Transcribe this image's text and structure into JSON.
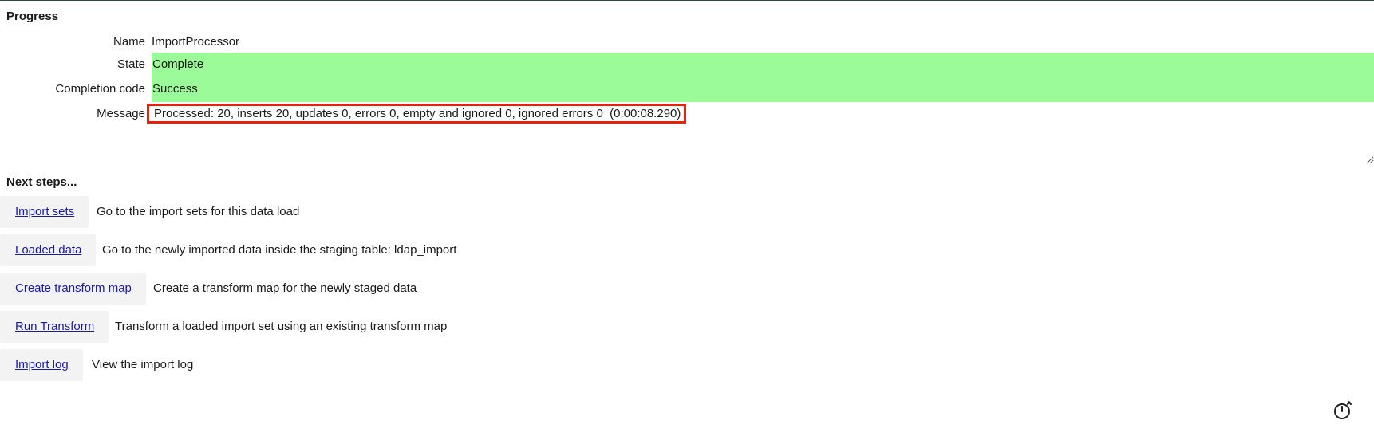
{
  "progress": {
    "title": "Progress",
    "fields": {
      "name": {
        "label": "Name",
        "value": "ImportProcessor"
      },
      "state": {
        "label": "State",
        "value": "Complete"
      },
      "completion_code": {
        "label": "Completion code",
        "value": "Success"
      },
      "message": {
        "label": "Message",
        "value": "Processed: 20, inserts 20, updates 0, errors 0, empty and ignored 0, ignored errors 0  (0:00:08.290)"
      }
    },
    "status_color": "#9bfb98",
    "highlight_color": "#e8210b"
  },
  "next_steps": {
    "title": "Next steps...",
    "items": [
      {
        "button": "Import sets",
        "description": "Go to the import sets for this data load"
      },
      {
        "button": "Loaded data",
        "description": "Go to the newly imported data inside the staging table: ldap_import"
      },
      {
        "button": "Create transform map",
        "description": "Create a transform map for the newly staged data"
      },
      {
        "button": "Run Transform",
        "description": "Transform a loaded import set using an existing transform map"
      },
      {
        "button": "Import log",
        "description": "View the import log"
      }
    ]
  },
  "icons": {
    "timer": "stopwatch-icon",
    "resize": "resize-grip-icon"
  }
}
